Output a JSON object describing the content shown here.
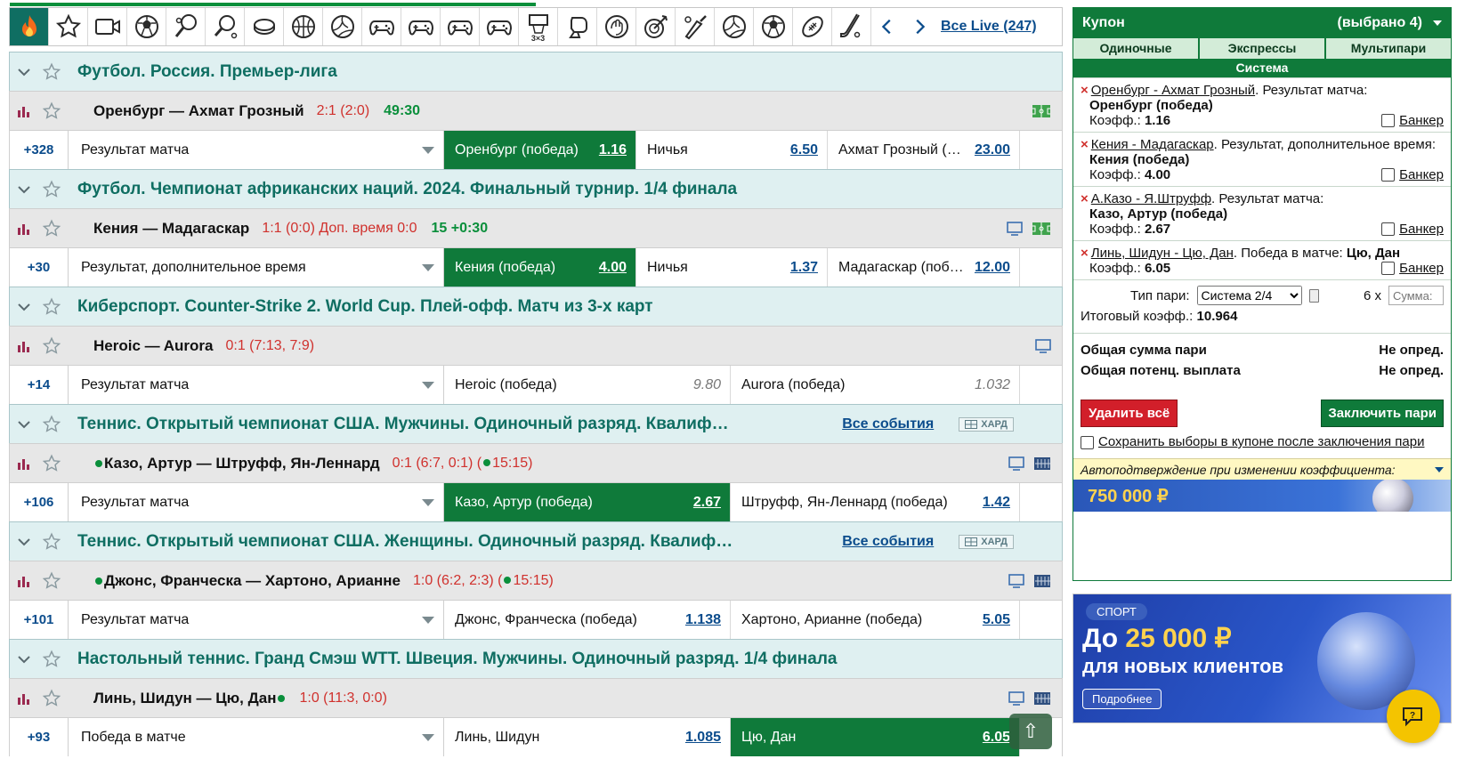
{
  "topbar": {
    "sports": [
      "fire-icon",
      "star-icon",
      "video-icon",
      "football-icon",
      "tennis-icon",
      "table-tennis-icon",
      "hockey-puck-icon",
      "basketball-icon",
      "volleyball-icon",
      "gamepad-icon",
      "gamepad-icon",
      "gamepad-icon",
      "gamepad-icon",
      "basketball-3x3-icon",
      "boxing-glove-icon",
      "handball-icon",
      "darts-icon",
      "cricket-icon",
      "beach-volleyball-icon",
      "futsal-icon",
      "american-football-icon",
      "field-hockey-icon"
    ],
    "badge_3x3": "3×3",
    "all_live": "Все Live (247)",
    "progress_fraction": 0.5
  },
  "events": [
    {
      "league": "Футбол. Россия. Премьер-лига",
      "teams": "Оренбург — Ахмат Грозный",
      "score": "2:1 (2:0)",
      "time": "49:30",
      "count": "+328",
      "market": "Результат матча",
      "outcomes": [
        {
          "label": "Оренбург (победа)",
          "odd": "1.16",
          "selected": true
        },
        {
          "label": "Ничья",
          "odd": "6.50"
        },
        {
          "label": "Ахмат Грозный (…",
          "odd": "23.00"
        }
      ]
    },
    {
      "league": "Футбол. Чемпионат африканских наций. 2024. Финальный турнир. 1/4 финала",
      "teams": "Кения — Мадагаскар",
      "score": "1:1 (0:0) Доп. время 0:0",
      "time": "15 +0:30",
      "count": "+30",
      "market": "Результат, дополнительное время",
      "outcomes": [
        {
          "label": "Кения (победа)",
          "odd": "4.00",
          "selected": true
        },
        {
          "label": "Ничья",
          "odd": "1.37"
        },
        {
          "label": "Мадагаскар (поб…",
          "odd": "12.00"
        }
      ]
    },
    {
      "league": "Киберспорт. Counter-Strike 2. World Cup. Плей-офф. Матч из 3-х карт",
      "teams": "Heroic — Aurora",
      "score": "0:1 (7:13, 7:9)",
      "count": "+14",
      "market": "Результат матча",
      "outcomes": [
        {
          "label": "Heroic (победа)",
          "odd": "9.80",
          "locked": true
        },
        {
          "label": "Aurora (победа)",
          "odd": "1.032",
          "locked": true
        }
      ]
    },
    {
      "league": "Теннис. Открытый чемпионат США. Мужчины. Одиночный разряд. Квалиф…",
      "all_events": "Все события",
      "surface": "ХАРД",
      "teams": "Казо, Артур — Штруфф, Ян-Леннард",
      "score": "0:1 (6:7, 0:1)",
      "serve_time": "15:15",
      "count": "+106",
      "market": "Результат матча",
      "outcomes": [
        {
          "label": "Казо, Артур (победа)",
          "odd": "2.67",
          "selected": true
        },
        {
          "label": "Штруфф, Ян-Леннард (победа)",
          "odd": "1.42"
        }
      ]
    },
    {
      "league": "Теннис. Открытый чемпионат США. Женщины. Одиночный разряд. Квалиф…",
      "all_events": "Все события",
      "surface": "ХАРД",
      "teams": "Джонс, Франческа — Хартоно, Арианне",
      "score": "1:0 (6:2, 2:3)",
      "serve_time": "15:15",
      "count": "+101",
      "market": "Результат матча",
      "outcomes": [
        {
          "label": "Джонс, Франческа (победа)",
          "odd": "1.138"
        },
        {
          "label": "Хартоно, Арианне (победа)",
          "odd": "5.05"
        }
      ]
    },
    {
      "league": "Настольный теннис. Гранд Смэш WTT. Швеция. Мужчины. Одиночный разряд. 1/4 финала",
      "teams": "Линь, Шидун — Цю, Дан",
      "score": "1:0 (11:3, 0:0)",
      "count": "+93",
      "market": "Победа в матче",
      "outcomes": [
        {
          "label": "Линь, Шидун",
          "odd": "1.085"
        },
        {
          "label": "Цю, Дан",
          "odd": "6.05",
          "selected": true
        }
      ]
    }
  ],
  "coupon": {
    "title": "Купон",
    "selected": "(выбрано 4)",
    "tabs": [
      "Одиночные",
      "Экспрессы",
      "Мультипари"
    ],
    "system_tab": "Система",
    "bets": [
      {
        "event": "Оренбург - Ахмат Грозный",
        "market": ". Результат матча:",
        "selection": "Оренбург (победа)",
        "coef_label": "Коэфф.:",
        "coef": "1.16",
        "banker": "Банкер"
      },
      {
        "event": "Кения - Мадагаскар",
        "market": ". Результат, дополнительное время:",
        "selection": "Кения (победа)",
        "coef_label": "Коэфф.:",
        "coef": "4.00",
        "banker": "Банкер"
      },
      {
        "event": "А.Казо - Я.Штруфф",
        "market": ". Результат матча:",
        "selection": "Казо, Артур (победа)",
        "coef_label": "Коэфф.:",
        "coef": "2.67",
        "banker": "Банкер"
      },
      {
        "event": "Линь, Шидун - Цю, Дан",
        "market": ". Победа в матче:",
        "selection": "Цю, Дан",
        "coef_label": "Коэфф.:",
        "coef": "6.05",
        "banker": "Банкер"
      }
    ],
    "bet_type_label": "Тип пари:",
    "bet_type_value": "Система 2/4",
    "multiplier": "6 x",
    "sum_placeholder": "Сумма:",
    "total_coef_label": "Итоговый коэфф.:",
    "total_coef": "10.964",
    "total_sum_label": "Общая сумма пари",
    "total_sum_value": "Не опред.",
    "total_payout_label": "Общая потенц. выплата",
    "total_payout_value": "Не опред.",
    "delete_all": "Удалить всё",
    "place_bet": "Заключить пари",
    "save_choices": "Сохранить выборы в купоне после заключения пари",
    "auto_confirm": "Автоподтверждение при изменении коэффициента:"
  },
  "banner1": {
    "amount": "750 000 ₽"
  },
  "banner2": {
    "tag": "СПОРТ",
    "amount_prefix": "До",
    "amount": "25 000 ₽",
    "subtitle": "для новых клиентов",
    "more": "Подробнее"
  },
  "colors": {
    "brand_green": "#0f7a3a",
    "teal": "#0f6e62",
    "link_blue": "#0b4c8c",
    "score_red": "#d0312d"
  }
}
